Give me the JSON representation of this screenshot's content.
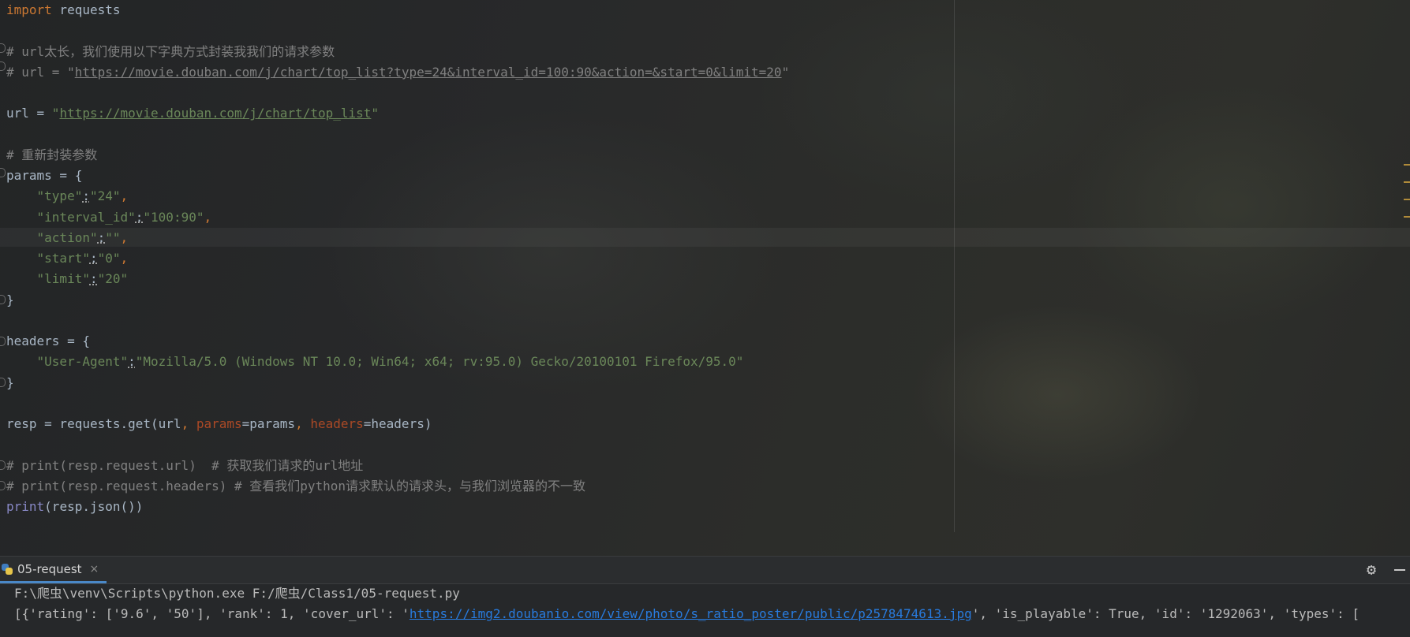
{
  "editor": {
    "lines": [
      {
        "id": "l1",
        "parts": [
          {
            "t": "import",
            "c": "kw"
          },
          {
            "t": " requests",
            "c": ""
          }
        ]
      },
      {
        "id": "l2",
        "parts": []
      },
      {
        "id": "l3",
        "parts": [
          {
            "t": "# url太长，我们使用以下字典方式封装我我们的请求参数",
            "c": "cm"
          }
        ]
      },
      {
        "id": "l4",
        "parts": [
          {
            "t": "# url = \"",
            "c": "cm"
          },
          {
            "t": "https://movie.douban.com/j/chart/top_list?type=24&interval_id=100:90&action=&start=0&limit=20",
            "c": "cm ln"
          },
          {
            "t": "\"",
            "c": "cm"
          }
        ]
      },
      {
        "id": "l5",
        "parts": []
      },
      {
        "id": "l6",
        "parts": [
          {
            "t": "url = ",
            "c": ""
          },
          {
            "t": "\"",
            "c": "st"
          },
          {
            "t": "https://movie.douban.com/j/chart/top_list",
            "c": "st ln"
          },
          {
            "t": "\"",
            "c": "st"
          }
        ]
      },
      {
        "id": "l7",
        "parts": []
      },
      {
        "id": "l8",
        "parts": [
          {
            "t": "# 重新封装参数",
            "c": "cm"
          }
        ]
      },
      {
        "id": "l9",
        "parts": [
          {
            "t": "params = {",
            "c": ""
          }
        ]
      },
      {
        "id": "l10",
        "parts": [
          {
            "t": "    ",
            "c": ""
          },
          {
            "t": "\"type\"",
            "c": "st"
          },
          {
            "t": ":",
            "c": "dot-under"
          },
          {
            "t": "\"24\"",
            "c": "st"
          },
          {
            "t": ",",
            "c": "kw"
          }
        ]
      },
      {
        "id": "l11",
        "parts": [
          {
            "t": "    ",
            "c": ""
          },
          {
            "t": "\"interval_id\"",
            "c": "st"
          },
          {
            "t": ":",
            "c": "dot-under"
          },
          {
            "t": "\"100:90\"",
            "c": "st"
          },
          {
            "t": ",",
            "c": "kw"
          }
        ]
      },
      {
        "id": "l12",
        "parts": [
          {
            "t": "    ",
            "c": ""
          },
          {
            "t": "\"action\"",
            "c": "st"
          },
          {
            "t": ":",
            "c": "dot-under"
          },
          {
            "t": "\"\"",
            "c": "st"
          },
          {
            "t": ",",
            "c": "kw"
          }
        ]
      },
      {
        "id": "l13",
        "parts": [
          {
            "t": "    ",
            "c": ""
          },
          {
            "t": "\"start\"",
            "c": "st"
          },
          {
            "t": ":",
            "c": "dot-under"
          },
          {
            "t": "\"0\"",
            "c": "st"
          },
          {
            "t": ",",
            "c": "kw"
          }
        ]
      },
      {
        "id": "l14",
        "parts": [
          {
            "t": "    ",
            "c": ""
          },
          {
            "t": "\"limit\"",
            "c": "st"
          },
          {
            "t": ":",
            "c": "dot-under"
          },
          {
            "t": "\"20\"",
            "c": "st"
          }
        ]
      },
      {
        "id": "l15",
        "parts": [
          {
            "t": "}",
            "c": ""
          }
        ]
      },
      {
        "id": "l16",
        "parts": []
      },
      {
        "id": "l17",
        "parts": [
          {
            "t": "headers = {",
            "c": ""
          }
        ]
      },
      {
        "id": "l18",
        "parts": [
          {
            "t": "    ",
            "c": ""
          },
          {
            "t": "\"User-Agent\"",
            "c": "st"
          },
          {
            "t": ":",
            "c": "dot-under"
          },
          {
            "t": "\"Mozilla/5.0 (Windows NT 10.0; Win64; x64; rv:95.0) Gecko/20100101 Firefox/95.0\"",
            "c": "st"
          }
        ]
      },
      {
        "id": "l19",
        "parts": [
          {
            "t": "}",
            "c": ""
          }
        ]
      },
      {
        "id": "l20",
        "parts": []
      },
      {
        "id": "l21",
        "parts": [
          {
            "t": "resp = requests.get(url",
            "c": ""
          },
          {
            "t": ", ",
            "c": "kw"
          },
          {
            "t": "params",
            "c": "pm"
          },
          {
            "t": "=params",
            "c": ""
          },
          {
            "t": ", ",
            "c": "kw"
          },
          {
            "t": "headers",
            "c": "pm"
          },
          {
            "t": "=headers)",
            "c": ""
          }
        ]
      },
      {
        "id": "l22",
        "parts": []
      },
      {
        "id": "l23",
        "parts": [
          {
            "t": "# print(resp.request.url)  # 获取我们请求的url地址",
            "c": "cm"
          }
        ]
      },
      {
        "id": "l24",
        "parts": [
          {
            "t": "# print(resp.request.headers) # 查看我们python请求默认的请求头，与我们浏览器的不一致",
            "c": "cm"
          }
        ]
      },
      {
        "id": "l25",
        "parts": [
          {
            "t": "print",
            "c": "fn"
          },
          {
            "t": "(resp.json())",
            "c": ""
          }
        ]
      }
    ]
  },
  "run_panel": {
    "tab_label": "05-request",
    "tab_close_glyph": "×",
    "command_line": "F:\\爬虫\\venv\\Scripts\\python.exe F:/爬虫/Class1/05-request.py",
    "output_prefix": "[{'rating': ['9.6', '50'], 'rank': 1, 'cover_url': '",
    "output_link": "https://img2.doubanio.com/view/photo/s_ratio_poster/public/p2578474613.jpg",
    "output_suffix": "', 'is_playable': True, 'id': '1292063', 'types': [",
    "gear_glyph": "⚙"
  },
  "icons": {
    "run_tab": "python-icon",
    "settings": "gear-icon",
    "hide": "minimize-icon"
  },
  "colors": {
    "keyword": "#cc7832",
    "comment": "#808080",
    "string": "#6a8759",
    "text": "#a9b7c6",
    "param": "#aa4926",
    "builtin": "#8888c6",
    "link": "#287bde"
  }
}
